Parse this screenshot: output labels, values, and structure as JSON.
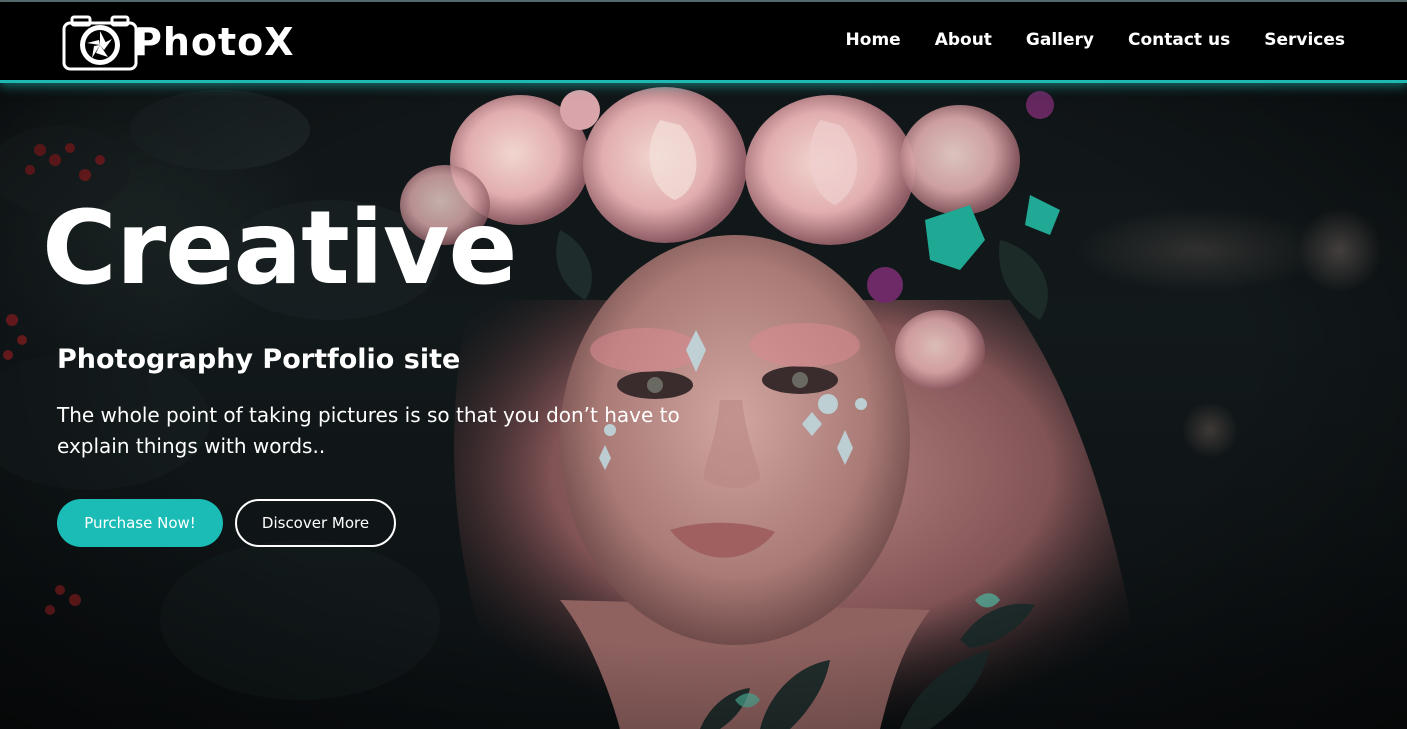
{
  "brand": {
    "name": "PhotoX",
    "logo_icon": "camera-aperture-icon"
  },
  "nav": {
    "items": [
      {
        "label": "Home"
      },
      {
        "label": "About"
      },
      {
        "label": "Gallery"
      },
      {
        "label": "Contact us"
      },
      {
        "label": "Services"
      }
    ]
  },
  "hero": {
    "title": "Creative",
    "subtitle": "Photography Portfolio site",
    "description": "The whole point of taking pictures is so that you don’t have to explain things with words..",
    "primary_button": "Purchase Now!",
    "secondary_button": "Discover More",
    "background_image": "portrait-woman-flower-crown"
  },
  "colors": {
    "accent": "#1bbcb6",
    "navbar_bg": "#000000",
    "text": "#ffffff"
  }
}
